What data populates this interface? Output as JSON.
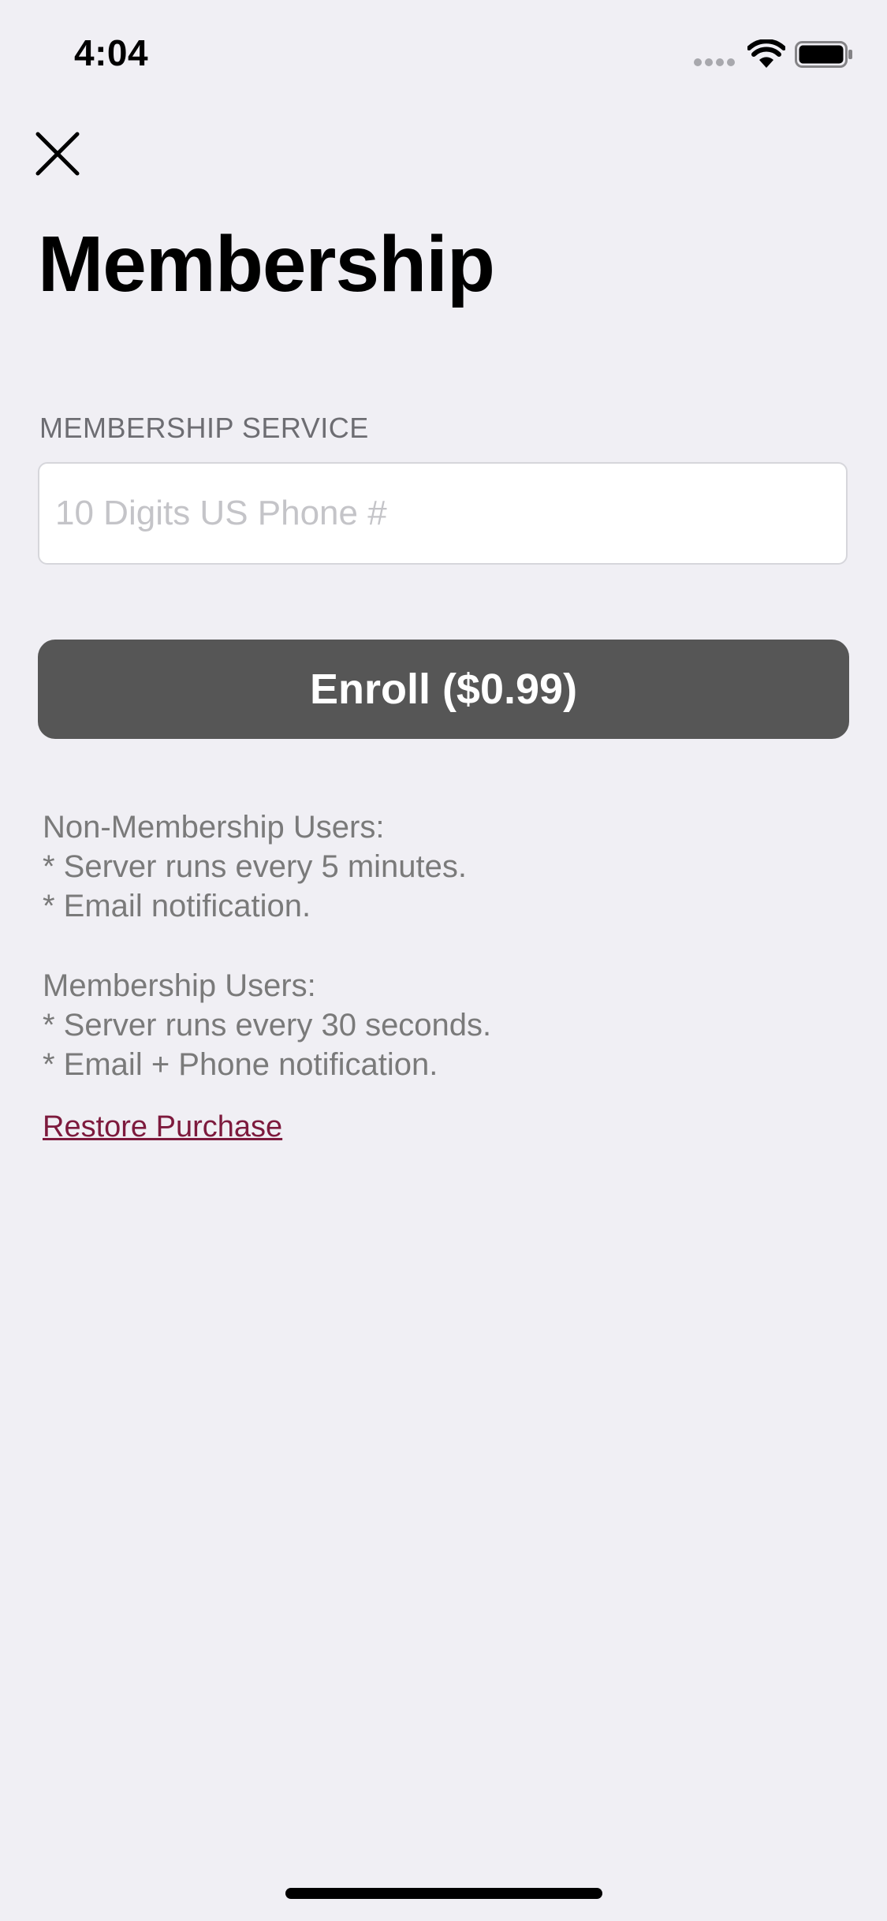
{
  "status_bar": {
    "time": "4:04"
  },
  "header": {
    "close_icon": "close-icon",
    "title": "Membership"
  },
  "form": {
    "section_label": "MEMBERSHIP SERVICE",
    "phone_placeholder": "10 Digits US Phone #",
    "phone_value": "",
    "enroll_label": "Enroll ($0.99)"
  },
  "info": {
    "non_member": {
      "heading": "Non-Membership Users:",
      "items": [
        "* Server runs every 5 minutes.",
        "* Email notification."
      ]
    },
    "member": {
      "heading": "Membership Users:",
      "items": [
        "* Server runs every 30 seconds.",
        "* Email + Phone notification."
      ]
    }
  },
  "restore_label": "Restore Purchase",
  "colors": {
    "background": "#f0eff4",
    "button": "#565656",
    "link": "#7d1a3d",
    "secondary_text": "#7a7a7a"
  }
}
